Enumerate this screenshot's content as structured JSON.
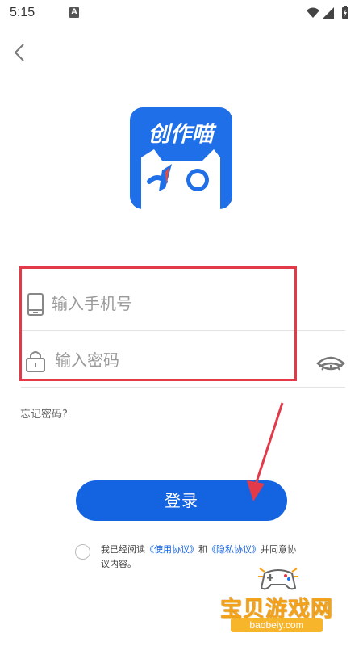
{
  "status_bar": {
    "time": "5:15",
    "notification_badge": "A"
  },
  "logo": {
    "text": "创作喵",
    "bg_color": "#1f6fe8"
  },
  "form": {
    "phone_placeholder": "输入手机号",
    "password_placeholder": "输入密码"
  },
  "forgot_password": "忘记密码?",
  "login_button": "登录",
  "agreement": {
    "prefix": "我已经阅读",
    "terms": "《使用协议》",
    "and": "和",
    "privacy": "《隐私协议》",
    "suffix": "并同意协议内容。"
  },
  "watermark": {
    "title": "宝贝游戏网",
    "url": "baobeiy.com"
  },
  "colors": {
    "accent": "#1463e0",
    "highlight": "#e23a48"
  }
}
